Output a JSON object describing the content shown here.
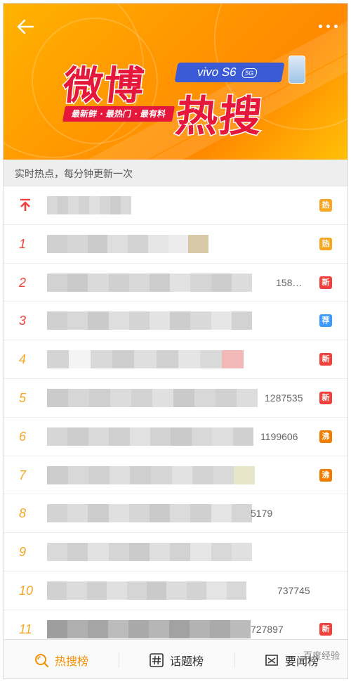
{
  "banner": {
    "logo_word1": "微博",
    "logo_word2": "热搜",
    "brand": "vivo S6",
    "brand_badge": "5G",
    "slogan": "最新鲜 · 最热门 · 最有料"
  },
  "subheader": {
    "text": "实时热点，每分钟更新一次"
  },
  "list": {
    "rows": [
      {
        "rank": "",
        "pinned": true,
        "count": "",
        "tag": "热",
        "tag_color": "#f5a623",
        "title_width": 120,
        "colors": [
          "#d8d8d8",
          "#cfcfcf",
          "#dcdcdc",
          "#d2d2d2",
          "#e0e0e0",
          "#d6d6d6",
          "#cccccc",
          "#dadada"
        ]
      },
      {
        "rank": "1",
        "pinned": false,
        "count": "",
        "tag": "热",
        "tag_color": "#f5a623",
        "title_width": 230,
        "colors": [
          "#d0d0d0",
          "#d6d6d6",
          "#cbcbcb",
          "#dedede",
          "#d3d3d3",
          "#e6e6e6",
          "#ececec",
          "#d8c9a6"
        ]
      },
      {
        "rank": "2",
        "pinned": false,
        "count": "158…",
        "tag": "新",
        "tag_color": "#f2403c",
        "title_width": 292,
        "colors": [
          "#d2d2d2",
          "#c9c9c9",
          "#dadada",
          "#d0d0d0",
          "#d8d8d8",
          "#cccccc",
          "#e2e2e2",
          "#d5d5d5",
          "#cdcdcd",
          "#dcdcdc"
        ]
      },
      {
        "rank": "3",
        "pinned": false,
        "count": "",
        "tag": "荐",
        "tag_color": "#3d9bff",
        "title_width": 292,
        "colors": [
          "#cfcfcf",
          "#d8d8d8",
          "#cacaca",
          "#dedede",
          "#d4d4d4",
          "#e3e3e3",
          "#cdcdcd",
          "#d9d9d9",
          "#e6e6e6",
          "#d2d2d2"
        ]
      },
      {
        "rank": "4",
        "pinned": false,
        "count": "",
        "tag": "新",
        "tag_color": "#f2403c",
        "title_width": 280,
        "colors": [
          "#d4d4d4",
          "#f4f4f4",
          "#d9d9d9",
          "#cecece",
          "#dfdfdf",
          "#d1d1d1",
          "#e5e5e5",
          "#dadada",
          "#f2b8b8"
        ]
      },
      {
        "rank": "5",
        "pinned": false,
        "count": "1287535",
        "tag": "新",
        "tag_color": "#f2403c",
        "title_width": 300,
        "colors": [
          "#cbcbcb",
          "#d7d7d7",
          "#cfcfcf",
          "#dcdcdc",
          "#d3d3d3",
          "#e0e0e0",
          "#cacaca",
          "#d8d8d8",
          "#d1d1d1",
          "#dddddd"
        ]
      },
      {
        "rank": "6",
        "pinned": false,
        "count": "1199606",
        "tag": "沸",
        "tag_color": "#f07c00",
        "title_width": 294,
        "colors": [
          "#d6d6d6",
          "#cdcdcd",
          "#dadada",
          "#cfcfcf",
          "#e1e1e1",
          "#d3d3d3",
          "#c9c9c9",
          "#d8d8d8",
          "#dedede",
          "#d0d0d0"
        ]
      },
      {
        "rank": "7",
        "pinned": false,
        "count": "",
        "tag": "沸",
        "tag_color": "#f07c00",
        "title_width": 296,
        "colors": [
          "#cccccc",
          "#d8d8d8",
          "#d1d1d1",
          "#dedede",
          "#cfcfcf",
          "#d6d6d6",
          "#e2e2e2",
          "#d3d3d3",
          "#dadada",
          "#e8e6c8"
        ]
      },
      {
        "rank": "8",
        "pinned": false,
        "count": "5179",
        "tag": "",
        "tag_color": "",
        "title_width": 292,
        "colors": [
          "#d3d3d3",
          "#dcdcdc",
          "#cdcdcd",
          "#e0e0e0",
          "#d6d6d6",
          "#cacaca",
          "#dbdbdb",
          "#d0d0d0",
          "#e4e4e4",
          "#d5d5d5"
        ]
      },
      {
        "rank": "9",
        "pinned": false,
        "count": "",
        "tag": "",
        "tag_color": "",
        "title_width": 292,
        "colors": [
          "#dadada",
          "#d0d0d0",
          "#e2e2e2",
          "#d5d5d5",
          "#cbcbcb",
          "#dfdfdf",
          "#d2d2d2",
          "#e6e6e6",
          "#d8d8d8",
          "#e0e0e0"
        ]
      },
      {
        "rank": "10",
        "pinned": false,
        "count": "737745",
        "tag": "",
        "tag_color": "",
        "title_width": 284,
        "colors": [
          "#d1d1d1",
          "#dbdbdb",
          "#cfcfcf",
          "#e0e0e0",
          "#d5d5d5",
          "#cacaca",
          "#dcdcdc",
          "#d3d3d3",
          "#e4e4e4",
          "#d8d8d8"
        ]
      },
      {
        "rank": "11",
        "pinned": false,
        "count": "727897",
        "tag": "新",
        "tag_color": "#f2403c",
        "title_width": 290,
        "colors": [
          "#9e9e9e",
          "#b0b0b0",
          "#a5a5a5",
          "#bcbcbc",
          "#a9a9a9",
          "#b6b6b6",
          "#a2a2a2",
          "#b3b3b3",
          "#aaaaaa",
          "#bbbbbb"
        ]
      }
    ]
  },
  "bottom_nav": {
    "items": [
      {
        "label": "热搜榜",
        "icon": "search-hot-icon",
        "active": true
      },
      {
        "label": "话题榜",
        "icon": "hashtag-icon",
        "active": false
      },
      {
        "label": "要闻榜",
        "icon": "news-icon",
        "active": false
      }
    ]
  },
  "watermark": "百度经验",
  "colors": {
    "accent": "#f29100",
    "hot": "#f2403c",
    "warm": "#f5a623",
    "recommend": "#3d9bff"
  }
}
